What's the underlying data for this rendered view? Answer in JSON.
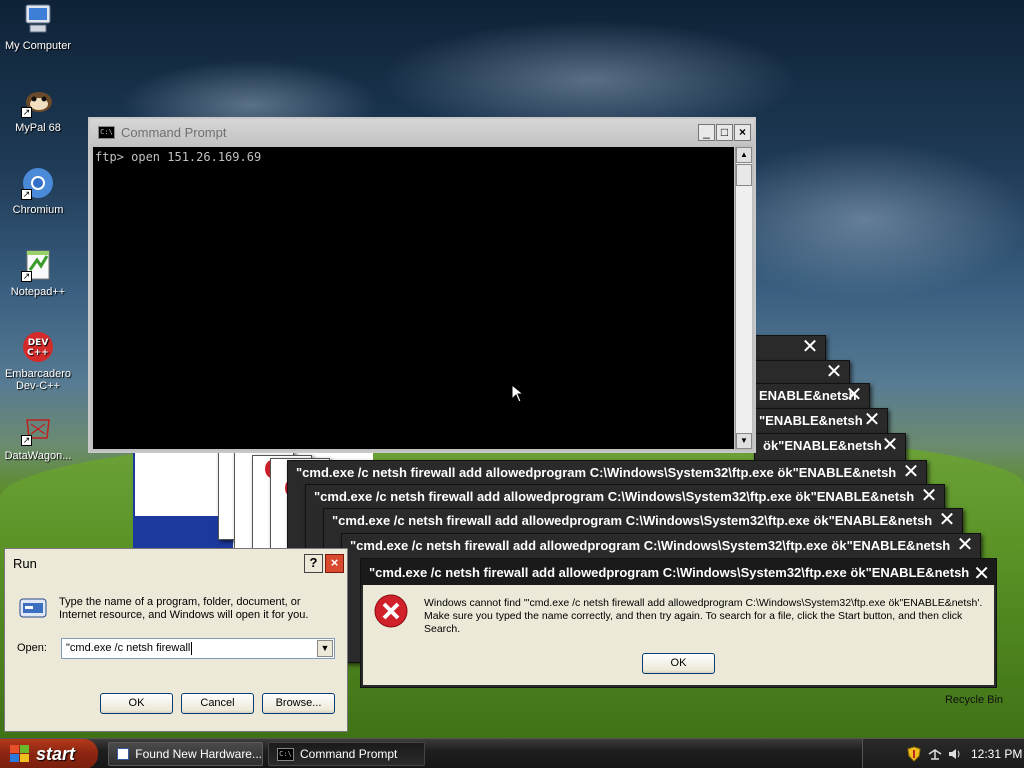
{
  "desktop": {
    "icons": [
      {
        "label": "My Computer",
        "icon": "computer-icon"
      },
      {
        "label": "MyPal 68",
        "icon": "mypal-icon"
      },
      {
        "label": "Chromium",
        "icon": "chromium-icon"
      },
      {
        "label": "Notepad++",
        "icon": "notepadpp-icon"
      },
      {
        "label": "Embarcadero Dev-C++",
        "icon": "devcpp-icon"
      },
      {
        "label": "DataWagon...",
        "icon": "datawagon-icon"
      }
    ],
    "recycle_bin": "Recycle Bin"
  },
  "cmd": {
    "title": "Command Prompt",
    "content": "ftp> open 151.26.169.69",
    "buttons": {
      "minimize": "_",
      "maximize": "□",
      "close": "×"
    }
  },
  "stacked_dialogs": [
    "",
    "",
    "ENABLE&netsh",
    "\"ENABLE&netsh",
    "ök\"ENABLE&netsh",
    "\"cmd.exe /c netsh firewall add allowedprogram C:\\Windows\\System32\\ftp.exe ök\"ENABLE&netsh",
    "\"cmd.exe /c netsh firewall add allowedprogram C:\\Windows\\System32\\ftp.exe ök\"ENABLE&netsh",
    "\"cmd.exe /c netsh firewall add allowedprogram C:\\Windows\\System32\\ftp.exe ök\"ENABLE&netsh",
    "\"cmd.exe /c netsh firewall add allowedprogram C:\\Windows\\System32\\ftp.exe ök\"ENABLE&netsh"
  ],
  "error_dialog": {
    "title": "\"cmd.exe /c netsh firewall add allowedprogram C:\\Windows\\System32\\ftp.exe ök\"ENABLE&netsh",
    "message": "Windows cannot find '\"cmd.exe /c netsh firewall add allowedprogram C:\\Windows\\System32\\ftp.exe ök\"ENABLE&netsh'. Make sure you typed the name correctly, and then try again. To search for a file, click the Start button, and then click Search.",
    "ok": "OK"
  },
  "run": {
    "title": "Run",
    "help": "?",
    "close": "×",
    "description": "Type the name of a program, folder, document, or Internet resource, and Windows will open it for you.",
    "open_label": "Open:",
    "open_value": "\"cmd.exe /c netsh firewall",
    "ok": "OK",
    "cancel": "Cancel",
    "browse": "Browse..."
  },
  "taskbar": {
    "start": "start",
    "tasks": [
      "Found New Hardware...",
      "Command Prompt"
    ],
    "clock": "12:31 PM"
  },
  "colors": {
    "accent": "#c6402a",
    "cmd_bg": "#000000",
    "error_red": "#d0202a"
  }
}
